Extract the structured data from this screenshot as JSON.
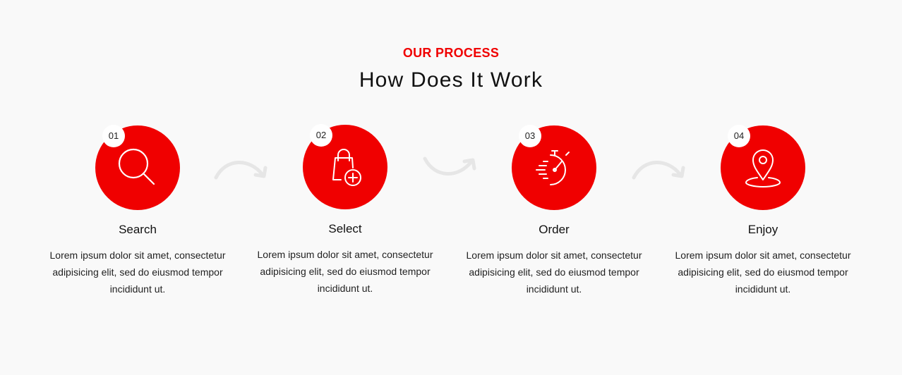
{
  "section": {
    "eyebrow": "OUR PROCESS",
    "title": "How Does It Work"
  },
  "colors": {
    "accent": "#f00000",
    "background": "#f9f9f9",
    "arrow": "#e6e6e6"
  },
  "steps": [
    {
      "number": "01",
      "name": "Search",
      "icon": "search-icon",
      "description": "Lorem ipsum dolor sit amet, consectetur adipisicing elit, sed do eiusmod tempor incididunt ut."
    },
    {
      "number": "02",
      "name": "Select",
      "icon": "shopping-bag-add-icon",
      "description": "Lorem ipsum dolor sit amet, consectetur adipisicing elit, sed do eiusmod tempor incididunt ut."
    },
    {
      "number": "03",
      "name": "Order",
      "icon": "stopwatch-icon",
      "description": "Lorem ipsum dolor sit amet, consectetur adipisicing elit, sed do eiusmod tempor incididunt ut."
    },
    {
      "number": "04",
      "name": "Enjoy",
      "icon": "location-pin-icon",
      "description": "Lorem ipsum dolor sit amet, consectetur adipisicing elit, sed do eiusmod tempor incididunt ut."
    }
  ],
  "connectors": [
    "curved-arrow-icon",
    "curved-arrow-icon",
    "curved-arrow-icon"
  ]
}
